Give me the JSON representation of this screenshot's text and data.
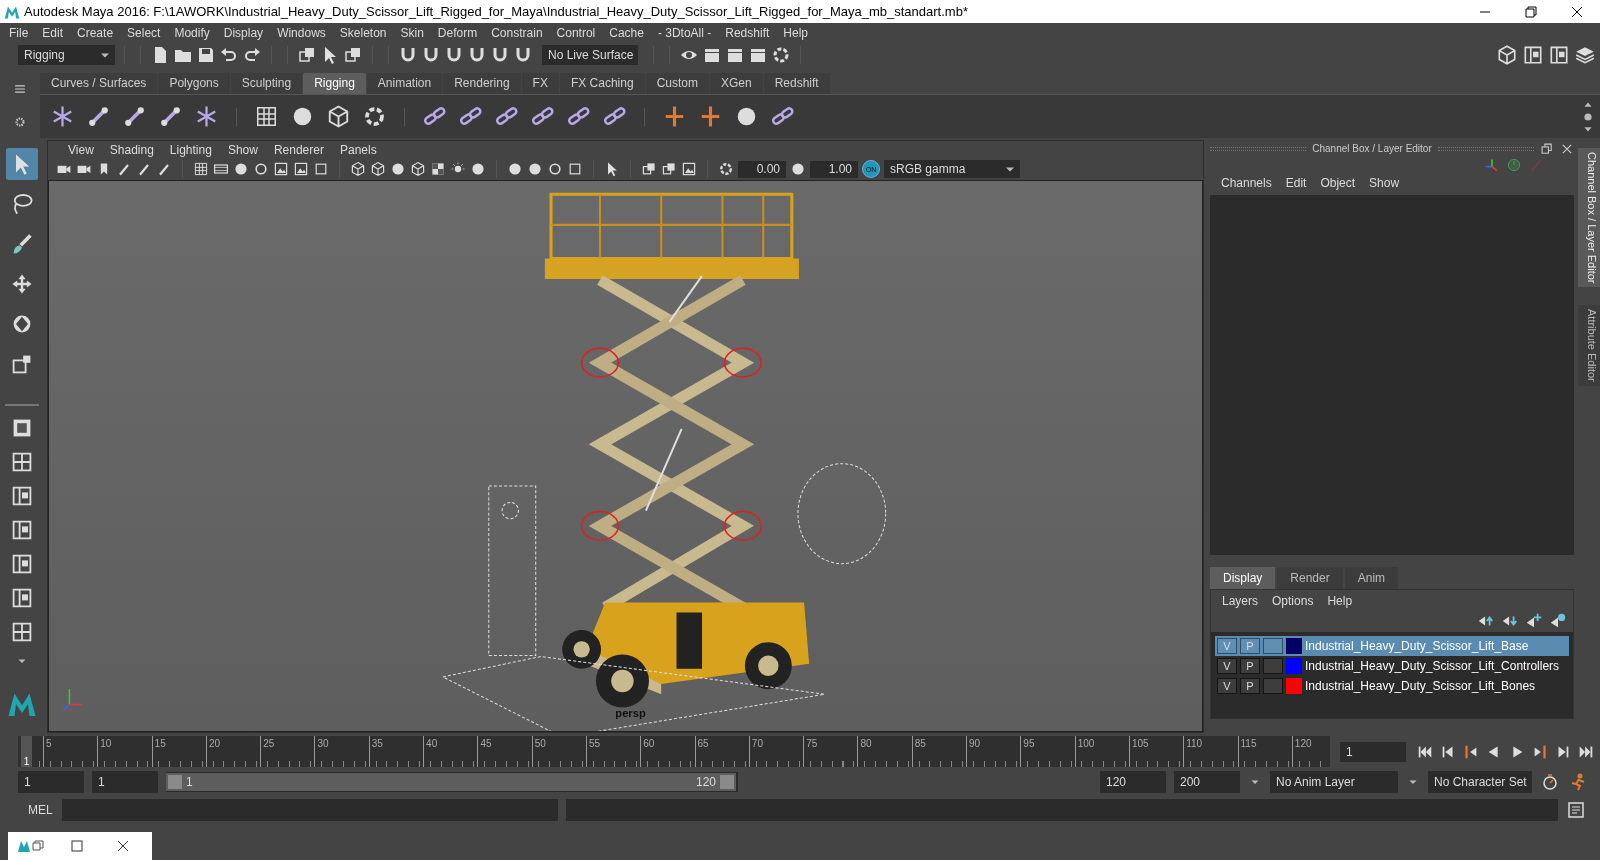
{
  "window": {
    "title": "Autodesk Maya 2016: F:\\1AWORK\\Industrial_Heavy_Duty_Scissor_Lift_Rigged_for_Maya\\Industrial_Heavy_Duty_Scissor_Lift_Rigged_for_Maya_mb_standart.mb*"
  },
  "menu_bar": [
    "File",
    "Edit",
    "Create",
    "Select",
    "Modify",
    "Display",
    "Windows",
    "Skeleton",
    "Skin",
    "Deform",
    "Constrain",
    "Control",
    "Cache",
    "- 3DtoAll -",
    "Redshift",
    "Help"
  ],
  "status_line": {
    "menu_set": "Rigging",
    "live_surface": "No Live Surface"
  },
  "shelf": {
    "tabs": [
      {
        "label": "Curves / Surfaces",
        "selected": false
      },
      {
        "label": "Polygons",
        "selected": false
      },
      {
        "label": "Sculpting",
        "selected": false
      },
      {
        "label": "Rigging",
        "selected": true
      },
      {
        "label": "Animation",
        "selected": false
      },
      {
        "label": "Rendering",
        "selected": false
      },
      {
        "label": "FX",
        "selected": false
      },
      {
        "label": "FX Caching",
        "selected": false
      },
      {
        "label": "Custom",
        "selected": false
      },
      {
        "label": "XGen",
        "selected": false
      },
      {
        "label": "Redshift",
        "selected": false
      }
    ]
  },
  "toolbox": {
    "tools": [
      {
        "selected": true
      },
      {
        "selected": false
      },
      {
        "selected": false
      },
      {
        "selected": false
      },
      {
        "selected": false
      },
      {
        "selected": false
      }
    ]
  },
  "viewport": {
    "menus": [
      "View",
      "Shading",
      "Lighting",
      "Show",
      "Renderer",
      "Panels"
    ],
    "exposure": "0.00",
    "gamma": "1.00",
    "color_management": "ON",
    "color_space": "sRGB gamma",
    "camera": "persp"
  },
  "channel_box": {
    "title": "Channel Box / Layer Editor",
    "menus": [
      "Channels",
      "Edit",
      "Object",
      "Show"
    ]
  },
  "layer_editor": {
    "tabs": [
      {
        "label": "Display",
        "selected": true
      },
      {
        "label": "Render",
        "selected": false
      },
      {
        "label": "Anim",
        "selected": false
      }
    ],
    "menus": [
      "Layers",
      "Options",
      "Help"
    ],
    "layers": [
      {
        "visible": "V",
        "playback": "P",
        "color": "#000066",
        "name": "Industrial_Heavy_Duty_Scissor_Lift_Base",
        "selected": true
      },
      {
        "visible": "V",
        "playback": "P",
        "color": "#0000ff",
        "name": "Industrial_Heavy_Duty_Scissor_Lift_Controllers",
        "selected": false
      },
      {
        "visible": "V",
        "playback": "P",
        "color": "#ff0000",
        "name": "Industrial_Heavy_Duty_Scissor_Lift_Bones",
        "selected": false
      }
    ]
  },
  "side_tabs": [
    {
      "label": "Channel Box / Layer Editor",
      "selected": true
    },
    {
      "label": "Attribute Editor",
      "selected": false
    }
  ],
  "time_slider": {
    "ticks": [
      "5",
      "10",
      "15",
      "20",
      "25",
      "30",
      "35",
      "40",
      "45",
      "50",
      "55",
      "60",
      "65",
      "70",
      "75",
      "80",
      "85",
      "90",
      "95",
      "100",
      "105",
      "110",
      "115",
      "120"
    ],
    "current_marker": "1",
    "level": 0,
    "current_frame": "1"
  },
  "range_slider": {
    "start": "1",
    "playback_start": "1",
    "range_start": "1",
    "range_end": "120",
    "level": 1,
    "playback_end": "120",
    "end": "200",
    "anim_layer": "No Anim Layer",
    "character_set": "No Character Set"
  },
  "command_line": {
    "language": "MEL"
  }
}
